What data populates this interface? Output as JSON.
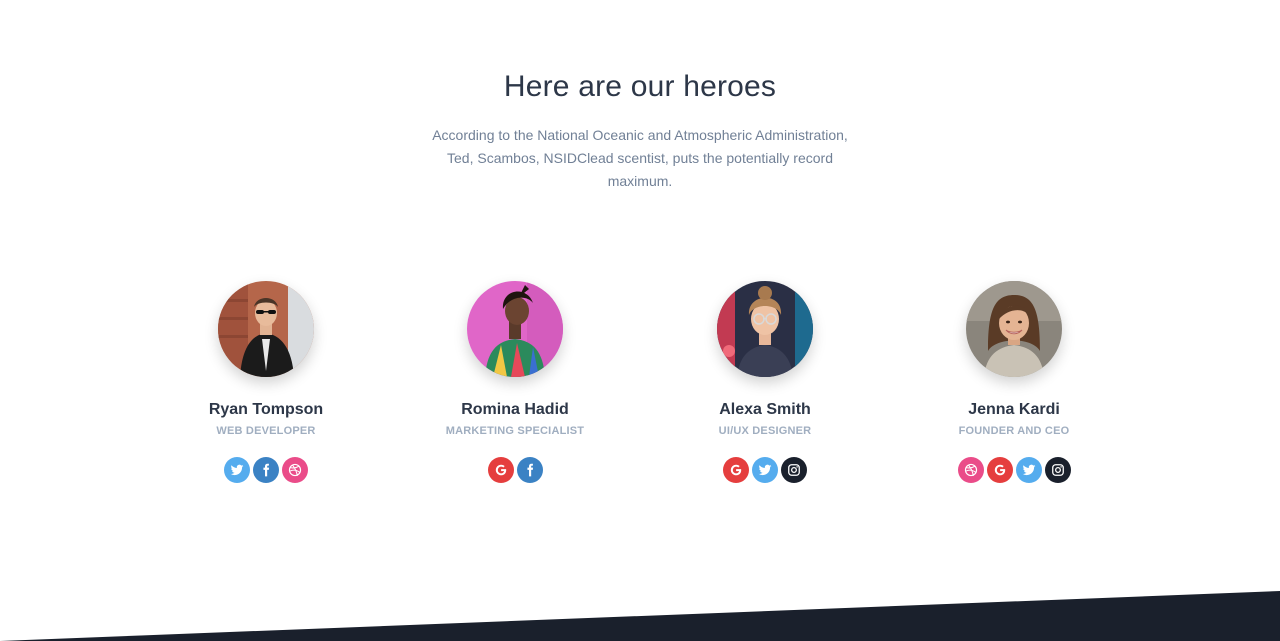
{
  "heading": {
    "title": "Here are our heroes",
    "subtitle": "According to the National Oceanic and Atmospheric Administration, Ted, Scambos, NSIDClead scentist, puts the potentially record maximum."
  },
  "colors": {
    "twitter": "#55acee",
    "facebook": "#3b82c4",
    "dribbble": "#ea4c89",
    "google": "#e53e3e",
    "instagram": "#1a202c",
    "footer": "#1a202c"
  },
  "team": [
    {
      "name": "Ryan Tompson",
      "role": "WEB DEVELOPER",
      "socials": [
        "twitter-icon",
        "facebook-icon",
        "dribbble-icon"
      ]
    },
    {
      "name": "Romina Hadid",
      "role": "MARKETING SPECIALIST",
      "socials": [
        "google-icon",
        "facebook-icon"
      ]
    },
    {
      "name": "Alexa Smith",
      "role": "UI/UX DESIGNER",
      "socials": [
        "google-icon",
        "twitter-icon",
        "instagram-icon"
      ]
    },
    {
      "name": "Jenna Kardi",
      "role": "FOUNDER AND CEO",
      "socials": [
        "dribbble-icon",
        "google-icon",
        "twitter-icon",
        "instagram-icon"
      ]
    }
  ]
}
